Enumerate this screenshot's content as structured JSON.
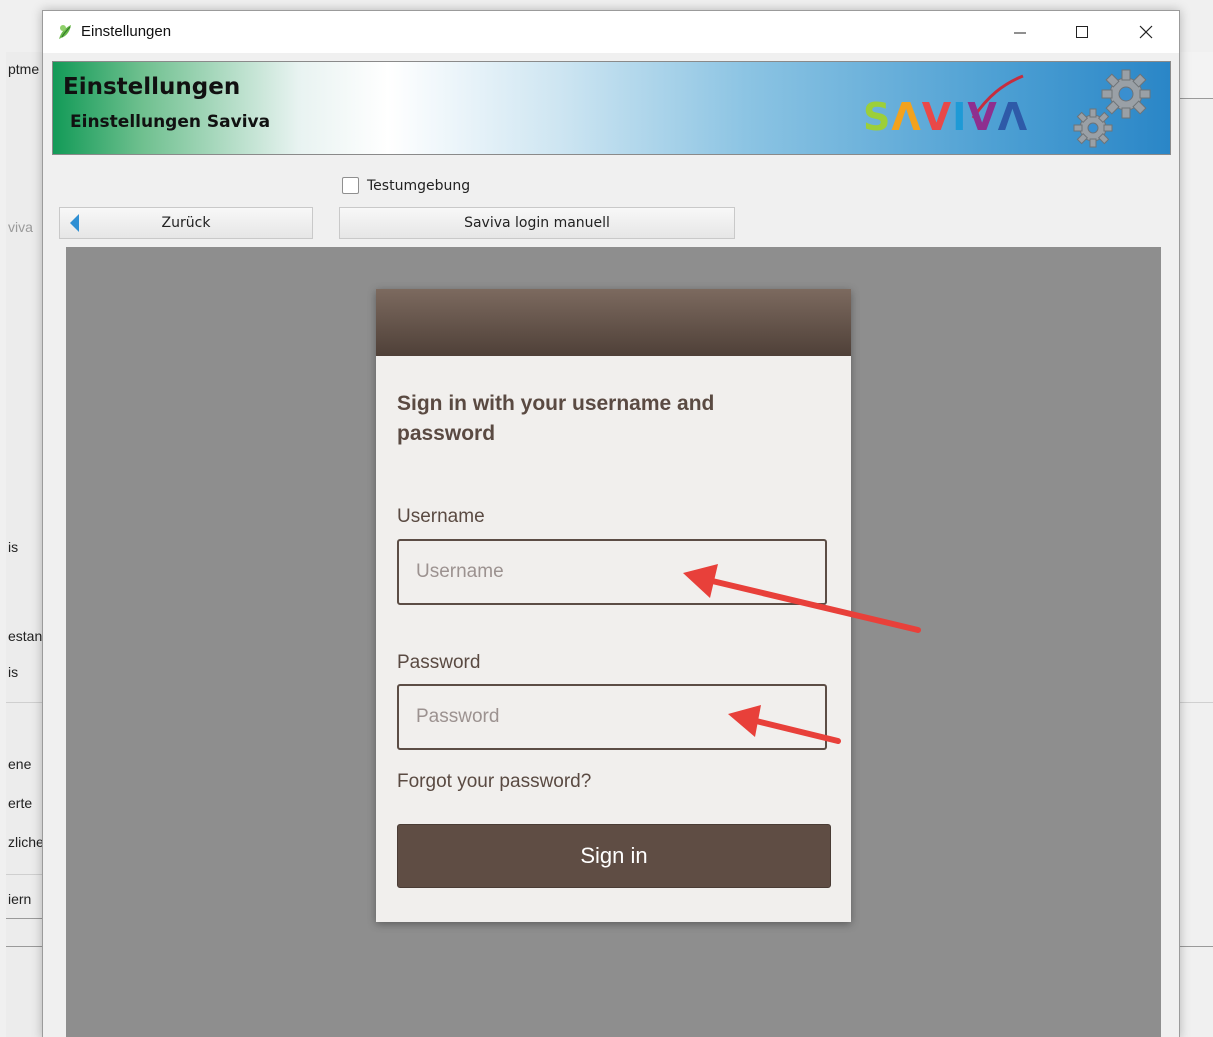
{
  "background_window": {
    "labels": [
      {
        "text": "ptme",
        "muted": false
      },
      {
        "text": "viva",
        "muted": true
      },
      {
        "text": "is",
        "muted": false
      },
      {
        "text": "estan",
        "muted": false
      },
      {
        "text": "is",
        "muted": false
      },
      {
        "text": "ene",
        "muted": false
      },
      {
        "text": "erte",
        "muted": false
      },
      {
        "text": "zliche",
        "muted": false
      },
      {
        "text": "iern",
        "muted": false
      }
    ]
  },
  "dialog": {
    "window_title": "Einstellungen",
    "window_controls": [
      "minimize",
      "maximize",
      "close"
    ],
    "banner": {
      "title": "Einstellungen",
      "subtitle": "Einstellungen Saviva",
      "logo_text": "SAVIVA",
      "logo_colors": {
        "S": "#9ccf3a",
        "A": "#f3a21d",
        "V": "#e94848",
        "I": "#1e9ad6",
        "V2": "#8e2f8f",
        "A2": "#2e5aa8"
      }
    },
    "checkbox": {
      "label": "Testumgebung",
      "checked": false
    },
    "back_button": {
      "label": "Zurück"
    },
    "manual_login_button": {
      "label": "Saviva login manuell"
    }
  },
  "login_card": {
    "heading": "Sign in with your username and password",
    "username_label": "Username",
    "username_placeholder": "Username",
    "password_label": "Password",
    "password_placeholder": "Password",
    "forgot_link": "Forgot your password?",
    "signin_button": "Sign in",
    "colors": {
      "header": "#5f4d44",
      "button": "#5f4d44",
      "text": "#5a4a42"
    }
  },
  "annotations": {
    "arrow_color": "#e8403a"
  }
}
